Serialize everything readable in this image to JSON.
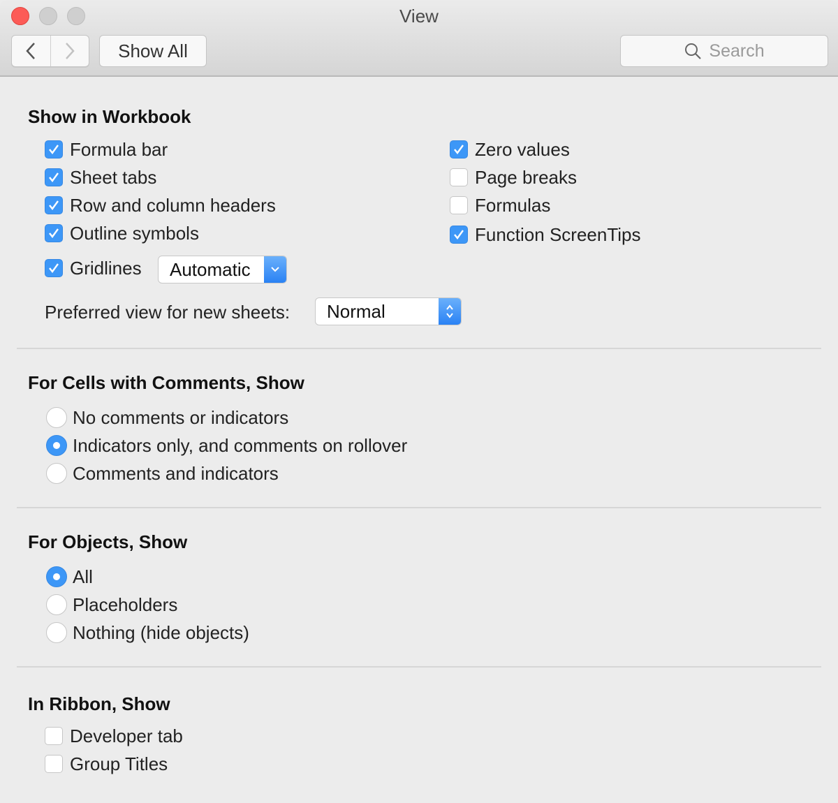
{
  "window": {
    "title": "View",
    "back_label": "‹",
    "forward_label": "›",
    "show_all_label": "Show All",
    "search_placeholder": "Search"
  },
  "show_in_workbook": {
    "title": "Show in Workbook",
    "left": [
      {
        "label": "Formula bar",
        "checked": true
      },
      {
        "label": "Sheet tabs",
        "checked": true
      },
      {
        "label": "Row and column headers",
        "checked": true
      },
      {
        "label": "Outline symbols",
        "checked": true
      },
      {
        "label": "Gridlines",
        "checked": true
      }
    ],
    "right": [
      {
        "label": "Zero values",
        "checked": true
      },
      {
        "label": "Page breaks",
        "checked": false
      },
      {
        "label": "Formulas",
        "checked": false
      },
      {
        "label": "Function ScreenTips",
        "checked": true
      }
    ],
    "gridlines_color": "Automatic",
    "preferred_view_label": "Preferred view for new sheets:",
    "preferred_view_value": "Normal"
  },
  "comments": {
    "title": "For Cells with Comments, Show",
    "options": [
      {
        "label": "No comments or indicators",
        "selected": false
      },
      {
        "label": "Indicators only, and comments on rollover",
        "selected": true
      },
      {
        "label": "Comments and indicators",
        "selected": false
      }
    ]
  },
  "objects": {
    "title": "For Objects, Show",
    "options": [
      {
        "label": "All",
        "selected": true
      },
      {
        "label": "Placeholders",
        "selected": false
      },
      {
        "label": "Nothing (hide objects)",
        "selected": false
      }
    ]
  },
  "ribbon": {
    "title": "In Ribbon, Show",
    "options": [
      {
        "label": "Developer tab",
        "checked": false
      },
      {
        "label": "Group Titles",
        "checked": false
      }
    ]
  },
  "colors": {
    "accent": "#3d97f7",
    "close": "#fc5b57"
  }
}
